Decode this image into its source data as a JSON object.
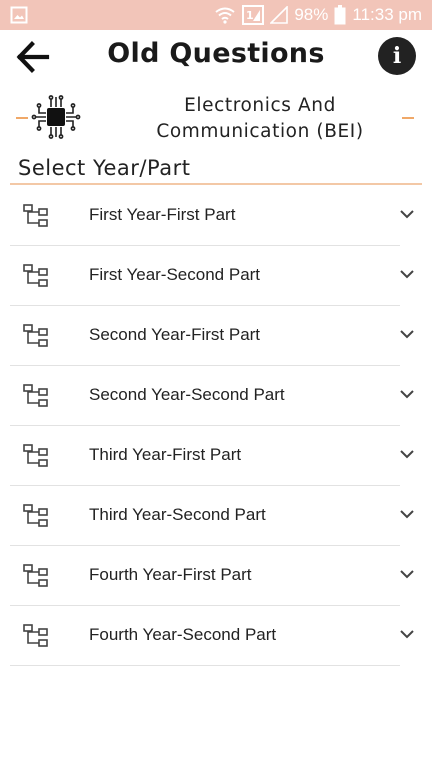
{
  "status_bar": {
    "battery": "98%",
    "time": "11:33 pm",
    "icons": [
      "image-icon",
      "wifi-icon",
      "sim-signal-icon",
      "signal-icon",
      "battery-icon"
    ]
  },
  "app_bar": {
    "title": "Old Questions",
    "back_icon": "arrow-left-icon",
    "info_icon": "info-icon",
    "info_glyph": "i"
  },
  "department": {
    "icon": "circuit-chip-icon",
    "line1": "Electronics And",
    "line2": "Communication (BEI)",
    "accent_color": "#f0a868"
  },
  "section": {
    "title": "Select Year/Part"
  },
  "items": [
    {
      "label": "First Year-First Part"
    },
    {
      "label": "First Year-Second Part"
    },
    {
      "label": "Second Year-First Part"
    },
    {
      "label": "Second Year-Second Part"
    },
    {
      "label": "Third Year-First Part"
    },
    {
      "label": "Third Year-Second Part"
    },
    {
      "label": "Fourth Year-First Part"
    },
    {
      "label": "Fourth Year-Second Part"
    }
  ],
  "item_icons": {
    "leading": "tree-structure-icon",
    "trailing": "chevron-down-icon"
  },
  "colors": {
    "status_bar": "#f2c5b9",
    "accent": "#f0a868",
    "divider": "#e2e2e2"
  }
}
